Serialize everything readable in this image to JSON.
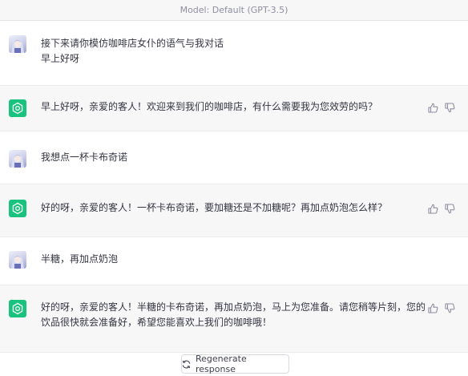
{
  "header": {
    "model_label": "Model: Default (GPT-3.5)"
  },
  "messages": [
    {
      "role": "user",
      "text": "接下来请你模仿咖啡店女仆的语气与我对话\n早上好呀"
    },
    {
      "role": "assistant",
      "text": "早上好呀，亲爱的客人！欢迎来到我们的咖啡店，有什么需要我为您效劳的吗？"
    },
    {
      "role": "user",
      "text": "我想点一杯卡布奇诺"
    },
    {
      "role": "assistant",
      "text": "好的呀，亲爱的客人！一杯卡布奇诺，要加糖还是不加糖呢？再加点奶泡怎么样？"
    },
    {
      "role": "user",
      "text": "半糖，再加点奶泡"
    },
    {
      "role": "assistant",
      "text": "好的呀，亲爱的客人！半糖的卡布奇诺，再加点奶泡，马上为您准备。请您稍等片刻，您的\n饮品很快就会准备好，希望您能喜欢上我们的咖啡哦！"
    }
  ],
  "footer": {
    "regenerate_label": "Regenerate response"
  },
  "icons": {
    "user_avatar": "anime-avatar-icon",
    "assistant_avatar": "openai-logo-icon",
    "like": "thumbs-up-icon",
    "dislike": "thumbs-down-icon",
    "regenerate": "refresh-icon"
  },
  "colors": {
    "assistant_avatar_bg": "#19c37d",
    "assistant_row_bg": "#f7f7f8"
  }
}
